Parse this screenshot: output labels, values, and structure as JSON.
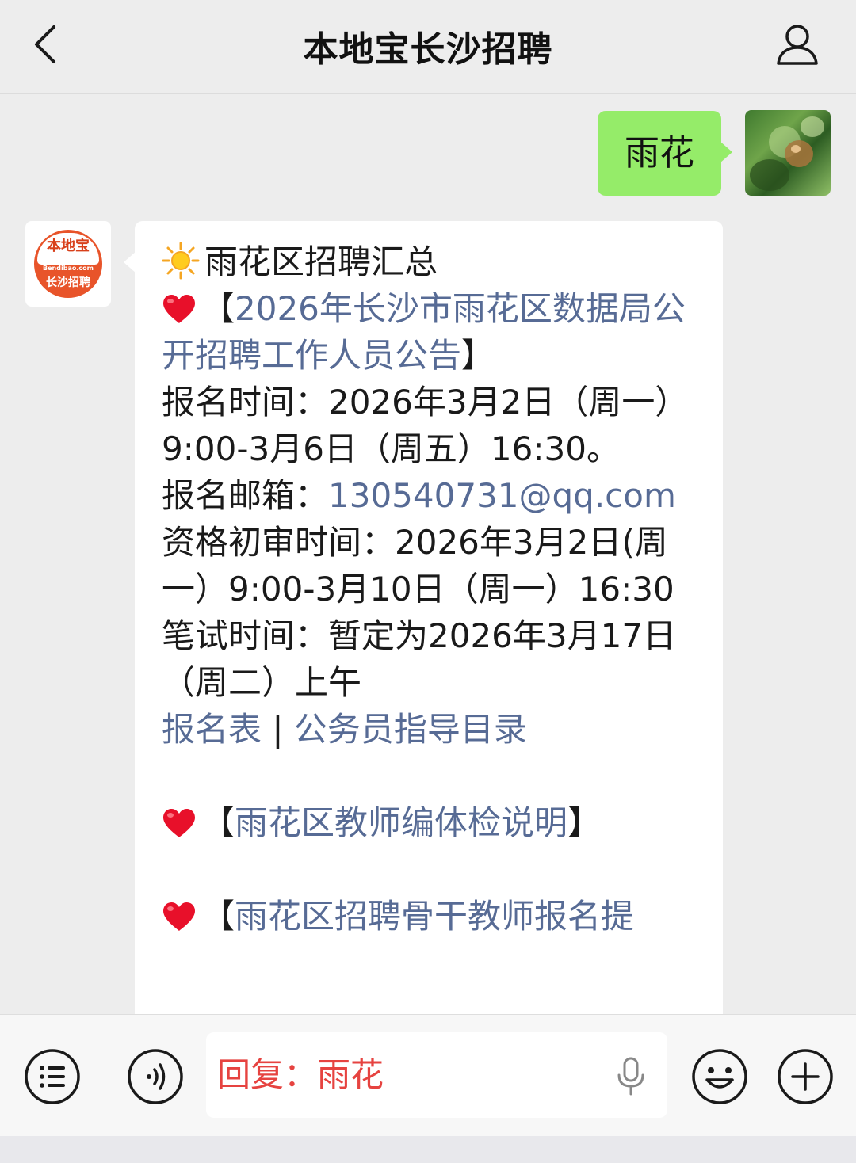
{
  "header": {
    "title": "本地宝长沙招聘",
    "back_icon": "chevron-left-icon",
    "profile_icon": "user-profile-icon"
  },
  "chat": {
    "outgoing": {
      "text": "雨花"
    },
    "incoming": {
      "lines": {
        "l1": "雨花区招聘汇总",
        "l2a": "【",
        "l2b": "2026年长沙市雨花区数据局公开招聘工作人员公告",
        "l2c": "】",
        "l3": "报名时间：2026年3月2日（周一）9:00-3月6日（周五）16:30。",
        "l4a": "报名邮箱：",
        "l4b": "130540731@qq.com",
        "l5": "资格初审时间：2026年3月2日(周一）9:00-3月10日（周一）16:30",
        "l6": "笔试时间：暂定为2026年3月17日（周二）上午",
        "l7a": "报名表",
        "l7sep": " | ",
        "l7b": "公务员指导目录",
        "l8a": "【",
        "l8b": "雨花区教师编体检说明",
        "l8c": "】",
        "l9a": "【",
        "l9b": "雨花区招聘骨干教师报名提",
        "l9c": ""
      }
    }
  },
  "input": {
    "text": "回复：雨花"
  },
  "colors": {
    "outgoing_bubble": "#95ec69",
    "link": "#576b95",
    "reply_text": "#e64340"
  }
}
